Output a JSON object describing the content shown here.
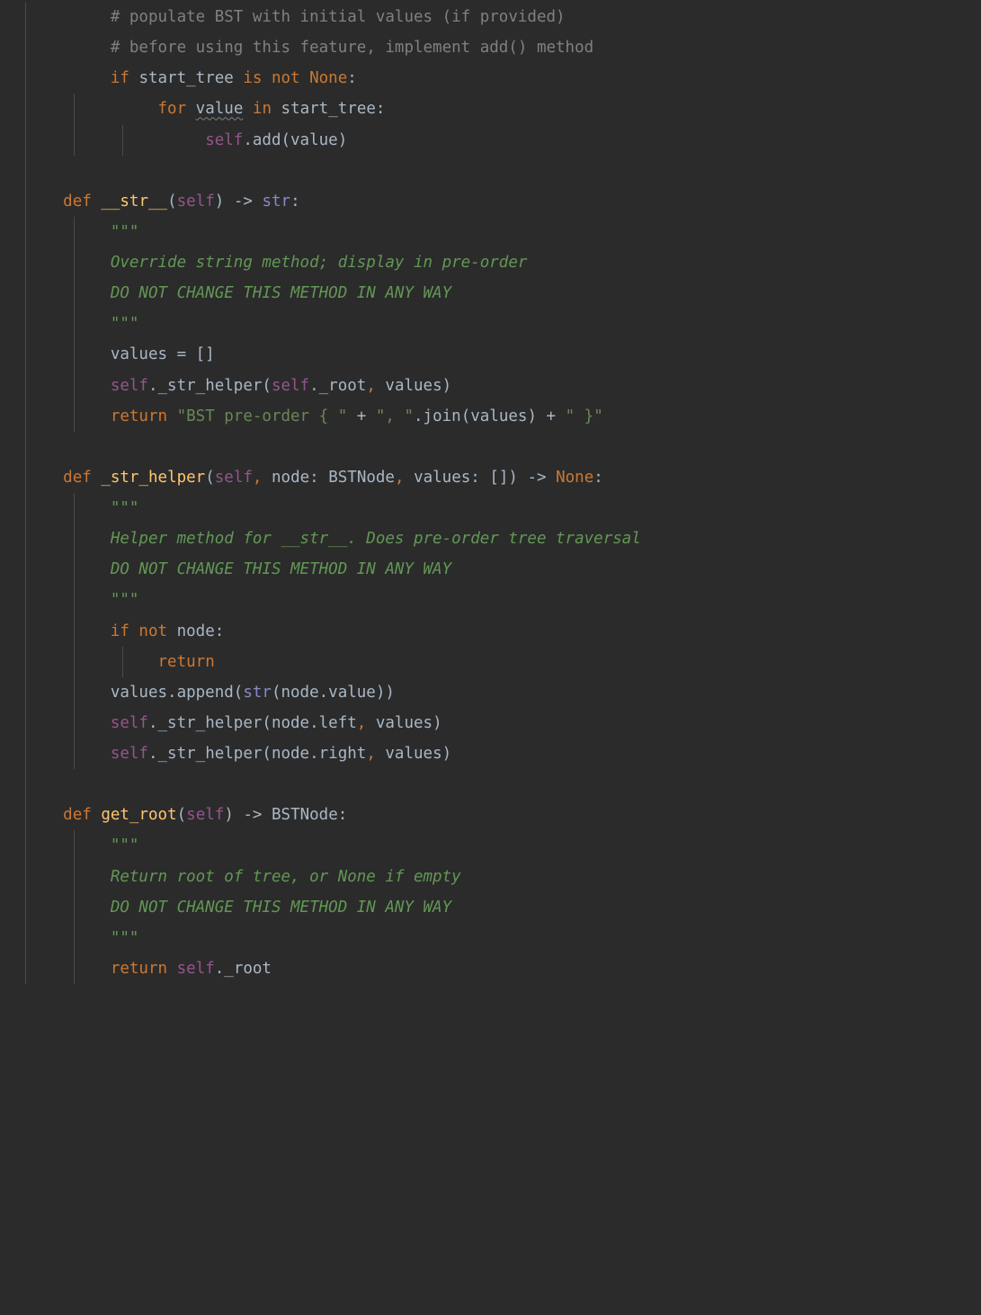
{
  "code": {
    "l1_comment": "# populate BST with initial values (if provided)",
    "l2_comment": "# before using this feature, implement add() method",
    "l3_if": "if",
    "l3_ident": " start_tree ",
    "l3_isnot": "is not ",
    "l3_none": "None",
    "l3_colon": ":",
    "l4_for": "for",
    "l4_value": "value",
    "l4_in": "in",
    "l4_start_tree": "start_tree:",
    "l5_self": "self",
    "l5_add": ".add(value)",
    "l7_def": "def ",
    "l7_fn": "__str__",
    "l7_sig_open": "(",
    "l7_self": "self",
    "l7_sig_close": ") -> ",
    "l7_ret": "str",
    "l7_colon": ":",
    "l8_docq": "\"\"\"",
    "l9_doc": "Override string method; display in pre-order",
    "l10_doc": "DO NOT CHANGE THIS METHOD IN ANY WAY",
    "l11_docq": "\"\"\"",
    "l12_values": "values = []",
    "l13_self": "self",
    "l13_call": "._str_helper(",
    "l13_self2": "self",
    "l13_rest": "._root",
    "l13_comma": ",",
    "l13_values": " values)",
    "l14_return": "return ",
    "l14_str1": "\"BST pre-order { \"",
    "l14_plus1": " + ",
    "l14_str2": "\", \"",
    "l14_join": ".join(values) + ",
    "l14_str3": "\" }\"",
    "l16_def": "def ",
    "l16_fn": "_str_helper",
    "l16_open": "(",
    "l16_self": "self",
    "l16_comma1": ",",
    "l16_node": " node: BSTNode",
    "l16_comma2": ",",
    "l16_values": " values: []) -> ",
    "l16_none": "None",
    "l16_colon": ":",
    "l17_docq": "\"\"\"",
    "l18_doc": "Helper method for __str__. Does pre-order tree traversal",
    "l19_doc": "DO NOT CHANGE THIS METHOD IN ANY WAY",
    "l20_docq": "\"\"\"",
    "l21_if": "if not",
    "l21_node": " node:",
    "l22_return": "return",
    "l23_values": "values.append(",
    "l23_str": "str",
    "l23_rest": "(node.value))",
    "l24_self": "self",
    "l24_call": "._str_helper(node.left",
    "l24_comma": ",",
    "l24_values": " values)",
    "l25_self": "self",
    "l25_call": "._str_helper(node.right",
    "l25_comma": ",",
    "l25_values": " values)",
    "l27_def": "def ",
    "l27_fn": "get_root",
    "l27_open": "(",
    "l27_self": "self",
    "l27_close": ") -> BSTNode:",
    "l28_docq": "\"\"\"",
    "l29_doc": "Return root of tree, or None if empty",
    "l30_doc": "DO NOT CHANGE THIS METHOD IN ANY WAY",
    "l31_docq": "\"\"\"",
    "l32_return": "return ",
    "l32_self": "self",
    "l32_root": "._root"
  }
}
